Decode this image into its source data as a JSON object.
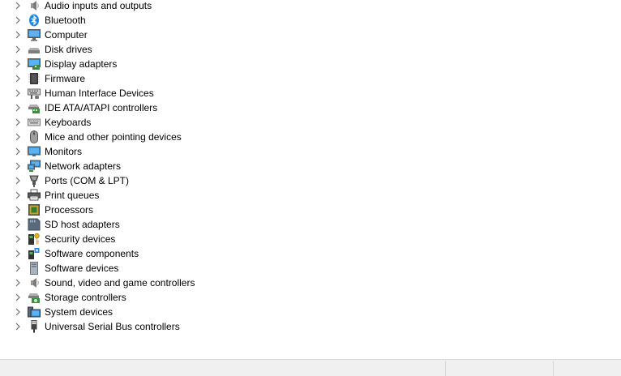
{
  "device_tree": {
    "categories": [
      {
        "label": "Audio inputs and outputs",
        "icon": "speaker-icon"
      },
      {
        "label": "Bluetooth",
        "icon": "bluetooth-icon"
      },
      {
        "label": "Computer",
        "icon": "computer-icon"
      },
      {
        "label": "Disk drives",
        "icon": "disk-drive-icon"
      },
      {
        "label": "Display adapters",
        "icon": "display-adapter-icon"
      },
      {
        "label": "Firmware",
        "icon": "firmware-icon"
      },
      {
        "label": "Human Interface Devices",
        "icon": "hid-icon"
      },
      {
        "label": "IDE ATA/ATAPI controllers",
        "icon": "ide-controller-icon"
      },
      {
        "label": "Keyboards",
        "icon": "keyboard-icon"
      },
      {
        "label": "Mice and other pointing devices",
        "icon": "mouse-icon"
      },
      {
        "label": "Monitors",
        "icon": "monitor-icon"
      },
      {
        "label": "Network adapters",
        "icon": "network-adapter-icon"
      },
      {
        "label": "Ports (COM & LPT)",
        "icon": "port-icon"
      },
      {
        "label": "Print queues",
        "icon": "printer-icon"
      },
      {
        "label": "Processors",
        "icon": "processor-icon"
      },
      {
        "label": "SD host adapters",
        "icon": "sd-adapter-icon"
      },
      {
        "label": "Security devices",
        "icon": "security-device-icon"
      },
      {
        "label": "Software components",
        "icon": "software-component-icon"
      },
      {
        "label": "Software devices",
        "icon": "software-device-icon"
      },
      {
        "label": "Sound, video and game controllers",
        "icon": "sound-controller-icon"
      },
      {
        "label": "Storage controllers",
        "icon": "storage-controller-icon"
      },
      {
        "label": "System devices",
        "icon": "system-device-icon"
      },
      {
        "label": "Universal Serial Bus controllers",
        "icon": "usb-icon"
      }
    ]
  },
  "status_bar": {
    "panes": [
      "",
      "",
      ""
    ]
  },
  "colors": {
    "chevron": "#6d6d6d",
    "status_bar_bg": "#f0f0f0",
    "status_bar_border": "#d7d7d7",
    "accent_blue": "#1e88e5"
  }
}
